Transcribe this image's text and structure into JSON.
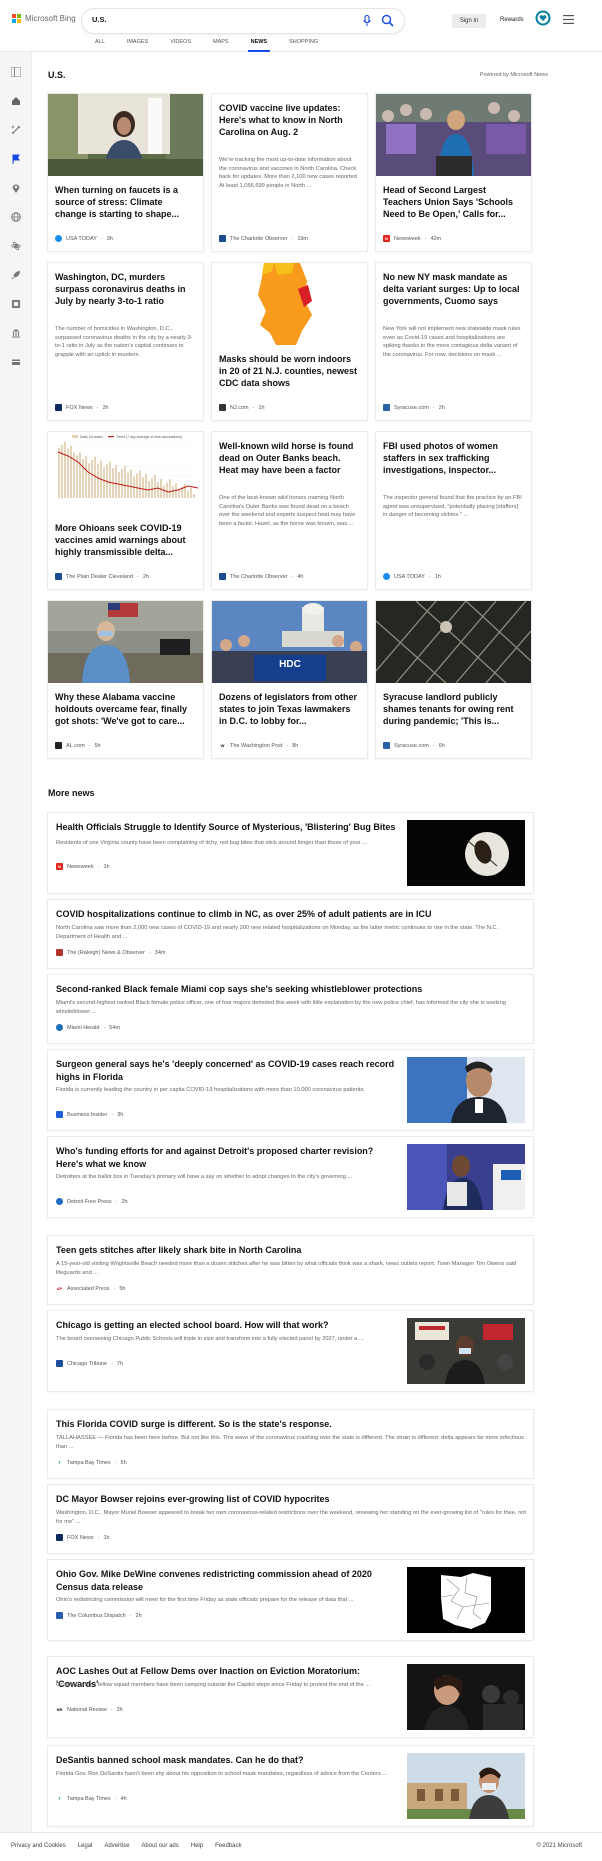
{
  "header": {
    "brand": "Microsoft Bing",
    "search_value": "U.S.",
    "sign_in": "Sign in",
    "rewards": "Rewards",
    "tabs": [
      "ALL",
      "IMAGES",
      "VIDEOS",
      "MAPS",
      "NEWS",
      "SHOPPING"
    ],
    "active_tab": "NEWS"
  },
  "rail_icons": [
    "home-icon",
    "gaming-icon",
    "flag-icon",
    "location-icon",
    "globe-icon",
    "science-icon",
    "rocket-icon",
    "film-icon",
    "bank-icon",
    "wallet-icon"
  ],
  "section": {
    "title": "U.S.",
    "powered": "Powered by Microsoft News"
  },
  "cards": [
    {
      "title": "When turning on faucets is a source of stress: Climate change is starting to shape...",
      "snippet": "",
      "source": "USA TODAY",
      "time": "3h"
    },
    {
      "title": "COVID vaccine live updates: Here's what to know in North Carolina on Aug. 2",
      "snippet": "We're tracking the most up-to-date information about the coronavirus and vaccines in North Carolina. Check back for updates. More than 2,100 new cases reported At least 1,056,699 people in North ...",
      "source": "The Charlotte Observer",
      "time": "19m"
    },
    {
      "title": "Head of Second Largest Teachers Union Says 'Schools Need to Be Open,' Calls for...",
      "snippet": "",
      "source": "Newsweek",
      "time": "42m"
    },
    {
      "title": "Washington, DC, murders surpass coronavirus deaths in July by nearly 3-to-1 ratio",
      "snippet": "The number of homicides in Washington, D.C., surpassed coronavirus deaths in the city by a nearly 3-to-1 ratio in July as the nation's capital continues to grapple with an uptick in murders.",
      "source": "FOX News",
      "time": "2h"
    },
    {
      "title": "Masks should be worn indoors in 20 of 21 N.J. counties, newest CDC data shows",
      "snippet": "",
      "source": "NJ.com",
      "time": "1h"
    },
    {
      "title": "No new NY mask mandate as delta variant surges: Up to local governments, Cuomo says",
      "snippet": "New York will not implement new statewide mask rules even as Covid-19 cases and hospitalizations are spiking thanks to the more contagious delta variant of the coronavirus. For now, decisions on mask ...",
      "source": "Syracuse.com",
      "time": "2h"
    },
    {
      "title": "More Ohioans seek COVID-19 vaccines amid warnings about highly transmissible delta...",
      "snippet": "",
      "source": "The Plain Dealer Cleveland",
      "time": "2h"
    },
    {
      "title": "Well-known wild horse is found dead on Outer Banks beach. Heat may have been a factor",
      "snippet": "One of the best-known wild horses roaming North Carolina's Outer Banks was found dead on a beach over the weekend and experts suspect heat may have been a factor. Hazel, as the horse was known, was ...",
      "source": "The Charlotte Observer",
      "time": "4h"
    },
    {
      "title": "FBI used photos of women staffers in sex trafficking investigations, inspector...",
      "snippet": "The inspector general found that the practice by an FBI agent was unsupervised, \"potentially placing [staffers] in danger of becoming victims.\" ...",
      "source": "USA TODAY",
      "time": "1h"
    },
    {
      "title": "Why these Alabama vaccine holdouts overcame fear, finally got shots: 'We've got to care...",
      "snippet": "",
      "source": "AL.com",
      "time": "5h"
    },
    {
      "title": "Dozens of legislators from other states to join Texas lawmakers in D.C. to lobby for...",
      "snippet": "",
      "source": "The Washington Post",
      "time": "8h"
    },
    {
      "title": "Syracuse landlord publicly shames tenants for owing rent during pandemic; 'This is...",
      "snippet": "",
      "source": "Syracuse.com",
      "time": "6h"
    }
  ],
  "chart_legend": [
    "Daily 2d doses",
    "Trend (7 day average of new vaccinations)"
  ],
  "map_text": "",
  "sign_text": "HDC",
  "more_news": {
    "title": "More news",
    "items": [
      {
        "title": "Health Officials Struggle to Identify Source of Mysterious, 'Blistering' Bug Bites",
        "snippet": "Residents of one Virginia county have been complaining of itchy, red bug bites that stick around longer than those of your ...",
        "source": "Newsweek",
        "time": "1h"
      },
      {
        "title": "COVID hospitalizations continue to climb in NC, as over 25% of adult patients are in ICU",
        "snippet": "North Carolina saw more than 2,000 new cases of COVID-19 and nearly 200 new related hospitalizations on Monday, as the latter metric continues to rise in the state. The N.C. Department of Health and ...",
        "source": "The (Raleigh) News & Observer",
        "time": "34m"
      },
      {
        "title": "Second-ranked Black female Miami cop says she's seeking whistleblower protections",
        "snippet": "Miami's second-highest ranked Black female police officer, one of four majors demoted this week with little explanation by the new police chief, has informed the city she is seeking whistleblower ...",
        "source": "Miami Herald",
        "time": "54m"
      },
      {
        "title": "Surgeon general says he's 'deeply concerned' as COVID-19 cases reach record highs in Florida",
        "snippet": "Florida is currently leading the country in per capita COVID-19 hospitalizations with more than 10,000 coronavirus patients.",
        "source": "Business Insider",
        "time": "3h"
      },
      {
        "title": "Who's funding efforts for and against Detroit's proposed charter revision? Here's what we know",
        "snippet": "Detroiters at the ballot box in Tuesday's primary will have a say on whether to adopt changes to the city's governing ...",
        "source": "Detroit Free Press",
        "time": "2h"
      },
      {
        "title": "Teen gets stitches after likely shark bite in North Carolina",
        "snippet": "A 15-year-old visiting Wrightsville Beach needed more than a dozen stitches after he was bitten by what officials think was a shark, news outlets report. Town Manager Tim Owens said lifeguards and ...",
        "source": "Associated Press",
        "time": "5h"
      },
      {
        "title": "Chicago is getting an elected school board. How will that work?",
        "snippet": "The board overseeing Chicago Public Schools will triple in size and transform into a fully elected panel by 2027, under a ...",
        "source": "Chicago Tribune",
        "time": "7h"
      },
      {
        "title": "This Florida COVID surge is different. So is the state's response.",
        "snippet": "TALLAHASSEE — Florida has been here before. But not like this. This wave of the coronavirus crashing over the state is different. The strain is different: delta appears far more infectious than ...",
        "source": "Tampa Bay Times",
        "time": "5h"
      },
      {
        "title": "DC Mayor Bowser rejoins ever-growing list of COVID hypocrites",
        "snippet": "Washington, D.C., Mayor Muriel Bowser appeared to break her own coronavirus-related restrictions over the weekend, renewing her standing on the ever-growing list of \"rules for thee, not for me\" ...",
        "source": "FOX News",
        "time": "1h"
      },
      {
        "title": "Ohio Gov. Mike DeWine convenes redistricting commission ahead of 2020 Census data release",
        "snippet": "Ohio's redistricting commission will meet for the first time Friday as state officials prepare for the release of data that ...",
        "source": "The Columbus Dispatch",
        "time": "2h"
      },
      {
        "title": "AOC Lashes Out at Fellow Dems over Inaction on Eviction Moratorium: 'Cowards'",
        "snippet": "Ocasio-Cortez's fellow squad members have been camping outside the Capitol steps since Friday to protest the end of the ...",
        "source": "National Review",
        "time": "3h"
      },
      {
        "title": "DeSantis banned school mask mandates. Can he do that?",
        "snippet": "Florida Gov. Ron DeSantis hasn't been shy about his opposition to school mask mandates, regardless of advice from the Centers ...",
        "source": "Tampa Bay Times",
        "time": "4h"
      }
    ]
  },
  "footer": {
    "links": [
      "Privacy and Cookies",
      "Legal",
      "Advertise",
      "About our ads",
      "Help",
      "Feedback"
    ],
    "copyright": "© 2021 Microsoft"
  },
  "colors": {
    "accent": "#174ae4",
    "brand_teal": "#00809d"
  }
}
